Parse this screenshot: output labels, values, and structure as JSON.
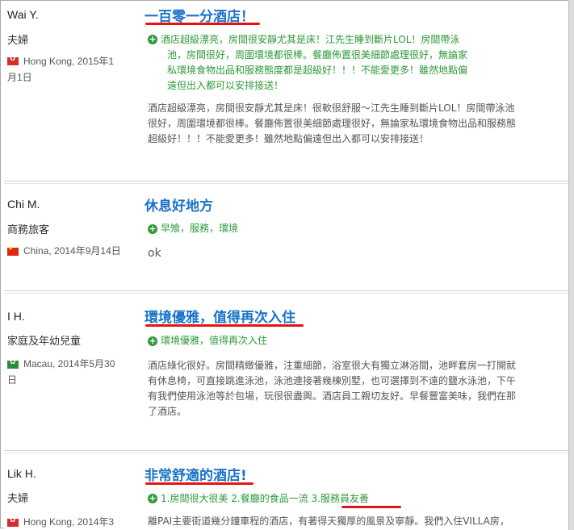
{
  "reviews": [
    {
      "username": "Wai Y.",
      "user_type": "夫婦",
      "flag": "hong-kong-flag-icon",
      "location_line1": "Hong Kong, 2015年1",
      "location_line2": "月1日",
      "title": "一百零一分酒店！",
      "likes": [
        "酒店超級漂亮，房間很安靜尤其是床！江先生睡到斷片LOL！房間帶泳",
        "池，房間很好，周圍環境都很棒。餐廳佈置很美細節處理很好，無論家",
        "私環境食物出品和服務態度都是超級好！！！不能愛更多！雖然地點偏",
        "遠但出入都可以安排接送！"
      ],
      "body": [
        "酒店超級漂亮，房間很安靜尤其是床！很軟很舒服～江先生睡到斷片LOL！房間帶泳池",
        "很好，周圍環境都很棒。餐廳佈置很美細節處理很好，無論家私環境食物出品和服務態",
        "超級好！！！不能愛更多！雖然地點偏遠但出入都可以安排接送！"
      ]
    },
    {
      "username": "Chi M.",
      "user_type": "商務旅客",
      "flag": "china-flag-icon",
      "location_line1": "China, 2014年9月14日",
      "location_line2": "",
      "title": "休息好地方",
      "likes": [
        "早飧，服務，環境"
      ],
      "body": [
        "ok"
      ]
    },
    {
      "username": "I H.",
      "user_type": "家庭及年幼兒童",
      "flag": "macau-flag-icon",
      "location_line1": "Macau, 2014年5月30",
      "location_line2": "日",
      "title": "環境優雅，值得再次入住",
      "likes": [
        "環境優雅，值得再次入住"
      ],
      "body": [
        "酒店綠化很好。房間精緻優雅，注重細節，浴室很大有獨立淋浴間，池畔套房一打開就",
        "有休息椅，可直接跳進泳池，泳池連接著幾棟別墅，也可選擇到不遠的鹽水泳池，下午",
        "有我們使用泳池等於包場，玩很很盡興。酒店員工親切友好。早餐豐富美味，我們在那",
        "了酒店。"
      ]
    },
    {
      "username": "Lik H.",
      "user_type": "夫婦",
      "flag": "hong-kong-flag-icon",
      "location_line1": "Hong Kong, 2014年3",
      "location_line2": "",
      "title": "非常舒適的酒店!",
      "likes": [
        "1.房間很大很美 2.餐廳的食品一流 3.服務員友善"
      ],
      "body": [
        "離PAI主要街道幾分鐘車程的酒店，有著得天獨厚的風景及寧靜。我們入住VILLA房，"
      ]
    }
  ],
  "colors": {
    "title": "#1a73c9",
    "likes": "#2d9a3a",
    "underline": "#e51414"
  }
}
